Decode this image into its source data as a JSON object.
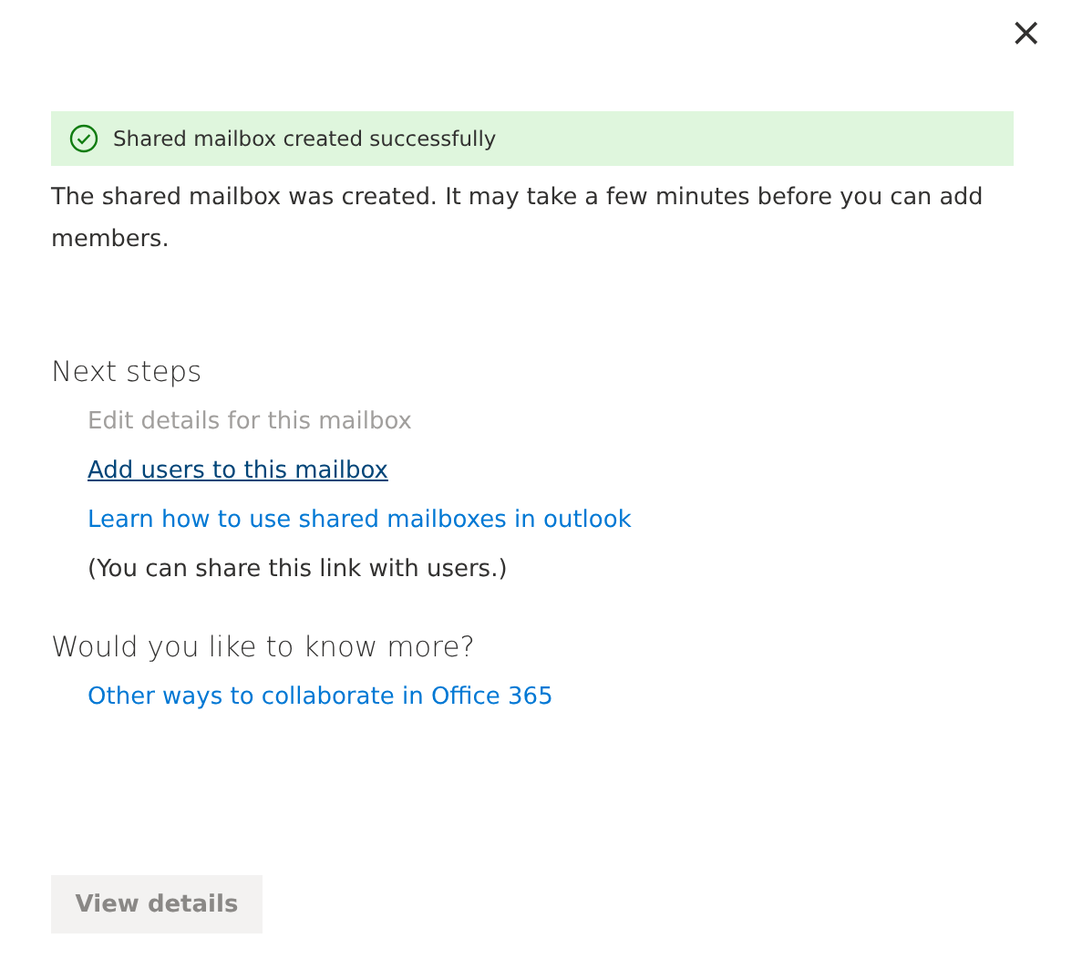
{
  "close_button": {
    "label": "×"
  },
  "banner": {
    "message": "Shared mailbox created successfully"
  },
  "description": "The shared mailbox was created. It may take a few minutes before you can add members.",
  "next_steps": {
    "heading": "Next steps",
    "items": [
      {
        "kind": "disabled",
        "text": "Edit details for this mailbox"
      },
      {
        "kind": "link",
        "text": "Add users to this mailbox",
        "focused": true
      },
      {
        "kind": "link",
        "text": "Learn how to use shared mailboxes in outlook",
        "focused": false
      },
      {
        "kind": "note",
        "text": "(You can share this link with users.)"
      }
    ]
  },
  "more": {
    "heading": "Would you like to know more?",
    "items": [
      {
        "kind": "link",
        "text": "Other ways to collaborate in Office 365",
        "focused": false
      }
    ]
  },
  "button": {
    "label": "View details",
    "disabled": true
  }
}
